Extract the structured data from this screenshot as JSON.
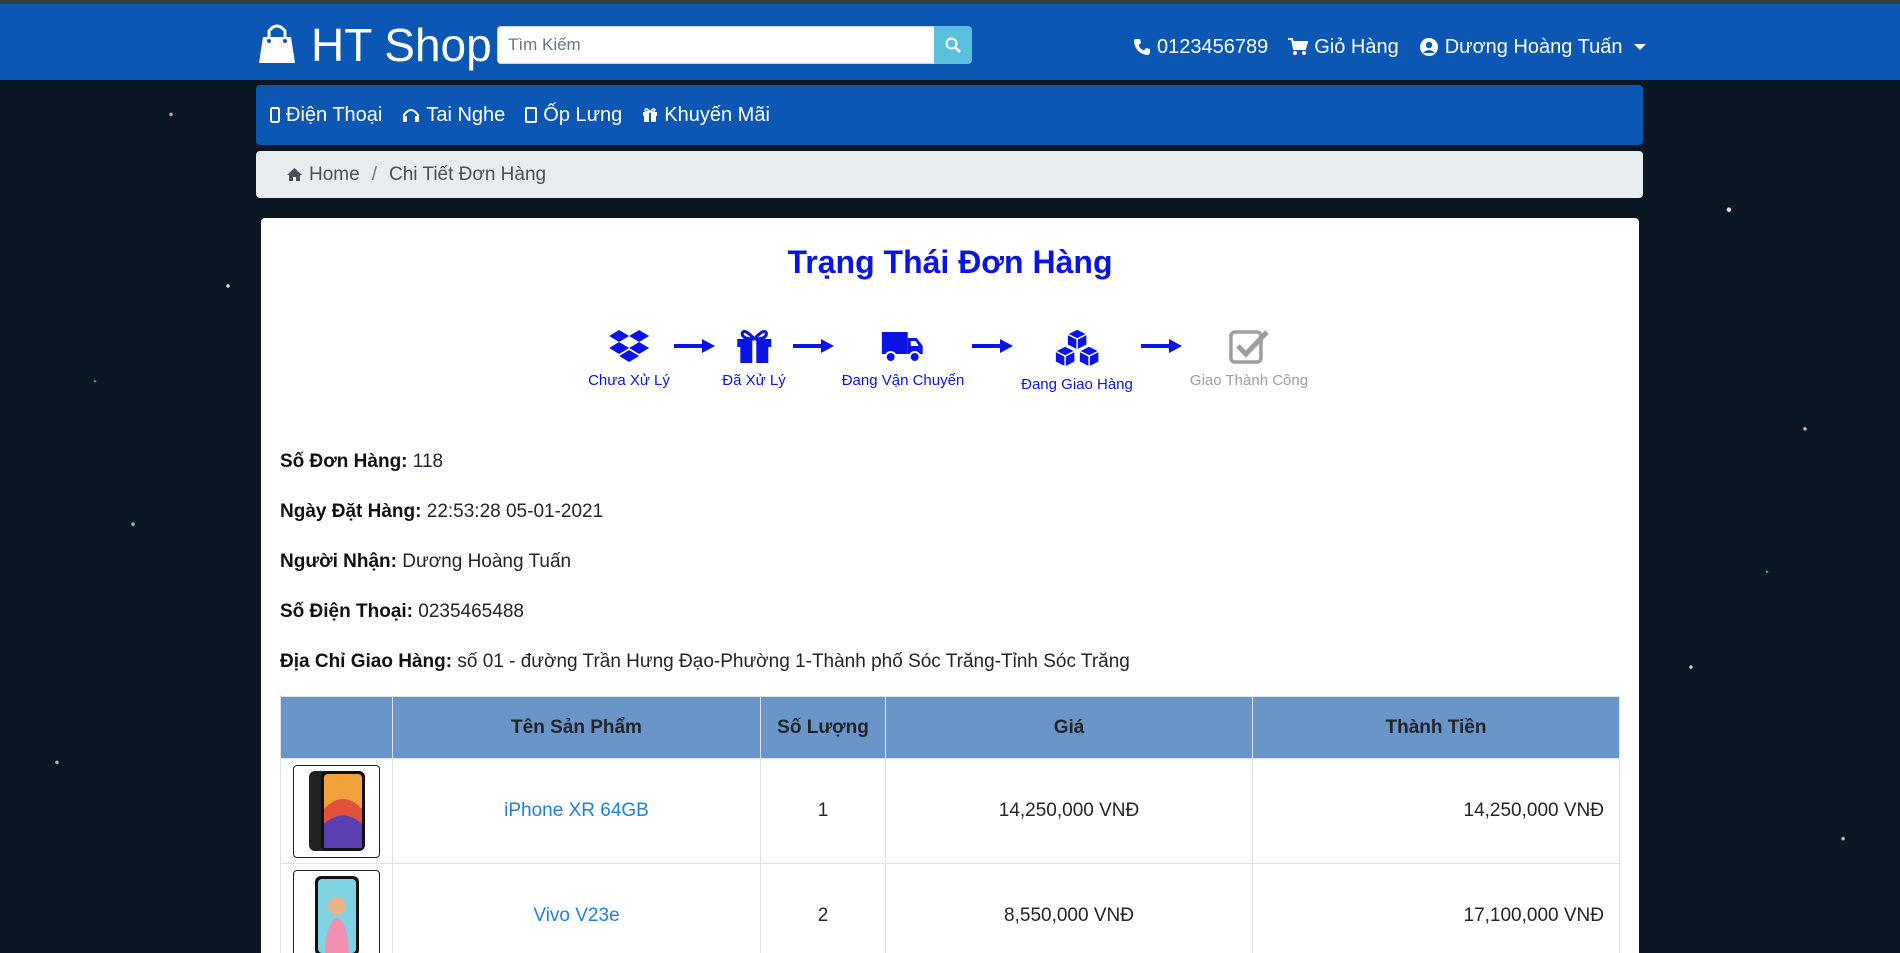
{
  "header": {
    "brand": "HT Shop",
    "search_placeholder": "Tìm Kiếm",
    "phone": "0123456789",
    "cart_label": "Giỏ Hàng",
    "user_name": "Dương Hoàng Tuấn",
    "colors": {
      "bar": "#0b57b3",
      "search_button": "#5bc0de"
    }
  },
  "nav": {
    "items": [
      {
        "label": "Điện Thoại",
        "icon": "mobile-icon"
      },
      {
        "label": "Tai Nghe",
        "icon": "headphones-icon"
      },
      {
        "label": "Ốp Lưng",
        "icon": "case-icon"
      },
      {
        "label": "Khuyến Mãi",
        "icon": "gift-icon"
      }
    ]
  },
  "breadcrumb": {
    "home": "Home",
    "current": "Chi Tiết Đơn Hàng"
  },
  "status": {
    "title": "Trạng Thái Đơn Hàng",
    "steps": [
      {
        "label": "Chưa Xử Lý",
        "icon": "dropbox-icon",
        "active": true
      },
      {
        "label": "Đã Xử Lý",
        "icon": "gift-icon",
        "active": true
      },
      {
        "label": "Đang Vận Chuyển",
        "icon": "truck-icon",
        "active": true
      },
      {
        "label": "Đang Giao Hàng",
        "icon": "cubes-icon",
        "active": true
      },
      {
        "label": "Giao Thành Công",
        "icon": "check-square-icon",
        "active": false
      }
    ],
    "colors": {
      "active": "#0a14e6",
      "inactive": "#9e9e9e"
    }
  },
  "order": {
    "number_label": "Số Đơn Hàng:",
    "number": "118",
    "date_label": "Ngày Đặt Hàng:",
    "date": "22:53:28 05-01-2021",
    "recipient_label": "Người Nhận:",
    "recipient": "Dương Hoàng Tuấn",
    "phone_label": "Số Điện Thoại:",
    "phone": "0235465488",
    "address_label": "Địa Chỉ Giao Hàng:",
    "address": "số 01 - đường Trần Hưng Đạo-Phường 1-Thành phố Sóc Trăng-Tỉnh Sóc Trăng"
  },
  "table": {
    "headers": [
      "",
      "Tên Sản Phẩm",
      "Số Lượng",
      "Giá",
      "Thành Tiền"
    ],
    "rows": [
      {
        "name": "iPhone XR 64GB",
        "qty": "1",
        "price": "14,250,000 VNĐ",
        "total": "14,250,000 VNĐ"
      },
      {
        "name": "Vivo V23e",
        "qty": "2",
        "price": "8,550,000 VNĐ",
        "total": "17,100,000 VNĐ"
      }
    ]
  }
}
